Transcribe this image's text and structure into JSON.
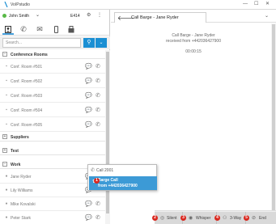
{
  "app": {
    "title": "VoIPstudio"
  },
  "window": {
    "minimize": "—",
    "maximize": "☐",
    "close": "✕"
  },
  "user": {
    "name": "John Smith",
    "extension": "E414"
  },
  "tabs": [
    {
      "name": "contacts",
      "icon": "person-icon"
    },
    {
      "name": "calls",
      "icon": "phone-icon"
    },
    {
      "name": "voicemail",
      "icon": "envelope-icon"
    },
    {
      "name": "mobile",
      "icon": "mobile-icon"
    },
    {
      "name": "fax",
      "icon": "fax-icon"
    }
  ],
  "search": {
    "placeholder": "Search..."
  },
  "groups": {
    "conference": "Conference Rooms",
    "suppliers": "Suppliers",
    "test": "Test",
    "work": "Work"
  },
  "conference_rooms": [
    "Conf. Room #501",
    "Conf. Room #502",
    "Conf. Room #503",
    "Conf. Room #504",
    "Conf. Room #505"
  ],
  "work_contacts": [
    "Jane Ryder",
    "Lily Williams",
    "Mike Kovalski",
    "Peter Stark"
  ],
  "popup": {
    "item1": "Call 2001",
    "item2_line1": "Barge Call",
    "item2_line2": "from +442036427900"
  },
  "call": {
    "tab_label": "Call Barge - Jane Ryder",
    "status_line1": "Call Barge - Jane Ryder",
    "status_line2": "received from +442036427900",
    "timer": "00:00:15"
  },
  "actions": {
    "silent": "Silent",
    "whisper": "Whisper",
    "threeway": "3-Way",
    "end": "End"
  },
  "badges": {
    "b1": "1",
    "b2": "2",
    "b3": "3",
    "b4": "4",
    "b5": "5"
  },
  "colors": {
    "accent": "#1b8fd3",
    "badge": "#d9281f",
    "online": "#58b947",
    "highlight": "#3c9ad6"
  }
}
